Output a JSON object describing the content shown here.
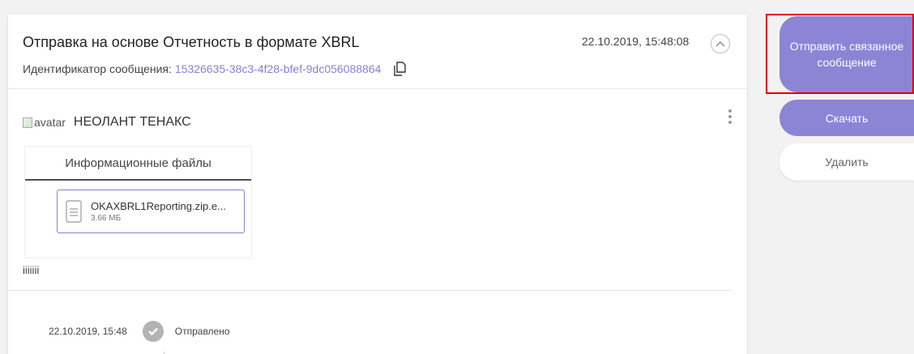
{
  "message": {
    "title": "Отправка на основе Отчетность в формате XBRL",
    "id_label": "Идентификатор сообщения:",
    "id_value": "15326635-38c3-4f28-bfef-9dc056088864",
    "timestamp": "22.10.2019, 15:48:08"
  },
  "sender": {
    "avatar_alt": "avatar",
    "name": "НЕОЛАНТ ТЕНАКС"
  },
  "files": {
    "tab_label": "Информационные файлы",
    "items": [
      {
        "name": "OKAXBRL1Reporting.zip.e...",
        "size": "3.66 МБ"
      }
    ]
  },
  "note": "iiiiiii",
  "status": {
    "date": "22.10.2019, 15:48",
    "text": "Отправлено"
  },
  "actions": {
    "send_related": "Отправить связанное сообщение",
    "download": "Скачать",
    "delete": "Удалить"
  },
  "colors": {
    "accent": "#8c85d6",
    "link": "#8a7fd1",
    "highlight": "#e00000"
  },
  "icons": [
    "copy-icon",
    "chevron-up-icon",
    "kebab-menu-icon",
    "file-icon",
    "check-icon"
  ]
}
